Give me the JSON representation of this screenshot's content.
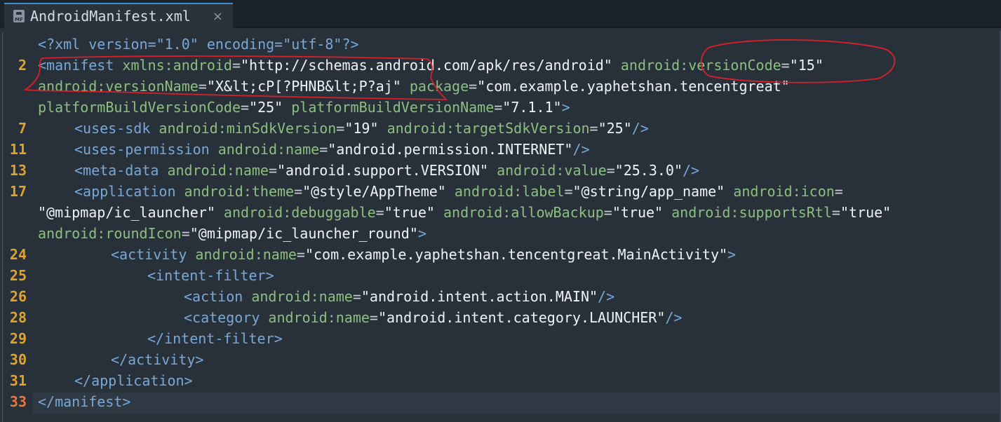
{
  "tab": {
    "title": "AndroidManifest.xml",
    "close_glyph": "×",
    "icon": "xml-file-icon",
    "icon_label": "MF"
  },
  "lines": [
    {
      "num": "",
      "code": [
        [
          "t",
          "<?xml version=\"1.0\" encoding=\"utf-8\"?>"
        ]
      ]
    },
    {
      "num": "2",
      "code": [
        [
          "t",
          "<manifest "
        ],
        [
          "a",
          "xmlns:android"
        ],
        [
          "p",
          "="
        ],
        [
          "s",
          "\"http://schemas.android.com/apk/res/android\""
        ],
        [
          "p",
          " "
        ],
        [
          "a",
          "android:versionCode"
        ],
        [
          "p",
          "="
        ],
        [
          "s",
          "\"15\""
        ]
      ]
    },
    {
      "num": "",
      "code": [
        [
          "a",
          "android:versionName"
        ],
        [
          "p",
          "="
        ],
        [
          "s",
          "\"X&lt;cP[?PHNB&lt;P?aj\""
        ],
        [
          "p",
          " "
        ],
        [
          "a",
          "package"
        ],
        [
          "p",
          "="
        ],
        [
          "s",
          "\"com.example.yaphetshan.tencentgreat\""
        ]
      ]
    },
    {
      "num": "",
      "code": [
        [
          "a",
          "platformBuildVersionCode"
        ],
        [
          "p",
          "="
        ],
        [
          "s",
          "\"25\""
        ],
        [
          "p",
          " "
        ],
        [
          "a",
          "platformBuildVersionName"
        ],
        [
          "p",
          "="
        ],
        [
          "s",
          "\"7.1.1\""
        ],
        [
          "t",
          ">"
        ]
      ]
    },
    {
      "num": "7",
      "indent": 1,
      "code": [
        [
          "t",
          "<uses-sdk "
        ],
        [
          "a",
          "android:minSdkVersion"
        ],
        [
          "p",
          "="
        ],
        [
          "s",
          "\"19\""
        ],
        [
          "p",
          " "
        ],
        [
          "a",
          "android:targetSdkVersion"
        ],
        [
          "p",
          "="
        ],
        [
          "s",
          "\"25\""
        ],
        [
          "t",
          "/>"
        ]
      ]
    },
    {
      "num": "11",
      "indent": 1,
      "code": [
        [
          "t",
          "<uses-permission "
        ],
        [
          "a",
          "android:name"
        ],
        [
          "p",
          "="
        ],
        [
          "s",
          "\"android.permission.INTERNET\""
        ],
        [
          "t",
          "/>"
        ]
      ]
    },
    {
      "num": "13",
      "indent": 1,
      "code": [
        [
          "t",
          "<meta-data "
        ],
        [
          "a",
          "android:name"
        ],
        [
          "p",
          "="
        ],
        [
          "s",
          "\"android.support.VERSION\""
        ],
        [
          "p",
          " "
        ],
        [
          "a",
          "android:value"
        ],
        [
          "p",
          "="
        ],
        [
          "s",
          "\"25.3.0\""
        ],
        [
          "t",
          "/>"
        ]
      ]
    },
    {
      "num": "17",
      "indent": 1,
      "code": [
        [
          "t",
          "<application "
        ],
        [
          "a",
          "android:theme"
        ],
        [
          "p",
          "="
        ],
        [
          "s",
          "\"@style/AppTheme\""
        ],
        [
          "p",
          " "
        ],
        [
          "a",
          "android:label"
        ],
        [
          "p",
          "="
        ],
        [
          "s",
          "\"@string/app_name\""
        ],
        [
          "p",
          " "
        ],
        [
          "a",
          "android:icon"
        ],
        [
          "p",
          "="
        ]
      ]
    },
    {
      "num": "",
      "code": [
        [
          "s",
          "\"@mipmap/ic_launcher\""
        ],
        [
          "p",
          " "
        ],
        [
          "a",
          "android:debuggable"
        ],
        [
          "p",
          "="
        ],
        [
          "s",
          "\"true\""
        ],
        [
          "p",
          " "
        ],
        [
          "a",
          "android:allowBackup"
        ],
        [
          "p",
          "="
        ],
        [
          "s",
          "\"true\""
        ],
        [
          "p",
          " "
        ],
        [
          "a",
          "android:supportsRtl"
        ],
        [
          "p",
          "="
        ],
        [
          "s",
          "\"true\""
        ]
      ]
    },
    {
      "num": "",
      "code": [
        [
          "a",
          "android:roundIcon"
        ],
        [
          "p",
          "="
        ],
        [
          "s",
          "\"@mipmap/ic_launcher_round\""
        ],
        [
          "t",
          ">"
        ]
      ]
    },
    {
      "num": "24",
      "indent": 2,
      "code": [
        [
          "t",
          "<activity "
        ],
        [
          "a",
          "android:name"
        ],
        [
          "p",
          "="
        ],
        [
          "s",
          "\"com.example.yaphetshan.tencentgreat.MainActivity\""
        ],
        [
          "t",
          ">"
        ]
      ]
    },
    {
      "num": "25",
      "indent": 3,
      "code": [
        [
          "t",
          "<intent-filter>"
        ]
      ]
    },
    {
      "num": "26",
      "indent": 4,
      "code": [
        [
          "t",
          "<action "
        ],
        [
          "a",
          "android:name"
        ],
        [
          "p",
          "="
        ],
        [
          "s",
          "\"android.intent.action.MAIN\""
        ],
        [
          "t",
          "/>"
        ]
      ]
    },
    {
      "num": "28",
      "indent": 4,
      "code": [
        [
          "t",
          "<category "
        ],
        [
          "a",
          "android:name"
        ],
        [
          "p",
          "="
        ],
        [
          "s",
          "\"android.intent.category.LAUNCHER\""
        ],
        [
          "t",
          "/>"
        ]
      ]
    },
    {
      "num": "29",
      "indent": 3,
      "code": [
        [
          "t",
          "</intent-filter>"
        ]
      ]
    },
    {
      "num": "30",
      "indent": 2,
      "code": [
        [
          "t",
          "</activity>"
        ]
      ]
    },
    {
      "num": "31",
      "indent": 1,
      "code": [
        [
          "t",
          "</application>"
        ]
      ]
    },
    {
      "num": "33",
      "current": true,
      "code": [
        [
          "t",
          "</manifest>"
        ]
      ]
    }
  ],
  "colors": {
    "tag": "#78a8d8",
    "attribute": "#8dbf7f",
    "string": "#f0f3f6",
    "line_number": "#e2a32c",
    "annotation": "#d8202a"
  }
}
